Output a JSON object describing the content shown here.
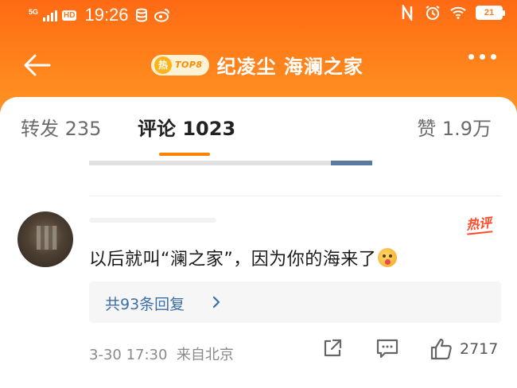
{
  "status_bar": {
    "network": "5G",
    "hd": "HD",
    "time": "19:26",
    "battery": "21"
  },
  "nav": {
    "hot_badge_char": "热",
    "hot_rank": "TOP8",
    "title": "纪凌尘 海澜之家"
  },
  "tabs": {
    "repost": "转发 235",
    "comment": "评论 1023",
    "like": "赞 1.9万"
  },
  "comment": {
    "hot_tag": "热评",
    "text": "以后就叫“澜之家”，因为你的海来了",
    "reply_summary": "共93条回复",
    "timestamp": "3-30 17:30",
    "location": "来自北京",
    "like_count": "2717"
  },
  "colors": {
    "brand_orange": "#ff7a1a",
    "tab_underline": "#ff8200",
    "link_blue": "#3c6ea7",
    "hot_red": "#ff4b2b"
  },
  "icons": [
    "back-arrow-icon",
    "more-icon",
    "wifi-icon",
    "alarm-icon",
    "nfc-icon",
    "weibo-icon",
    "share-icon",
    "comment-icon",
    "like-icon",
    "chevron-right-icon"
  ]
}
